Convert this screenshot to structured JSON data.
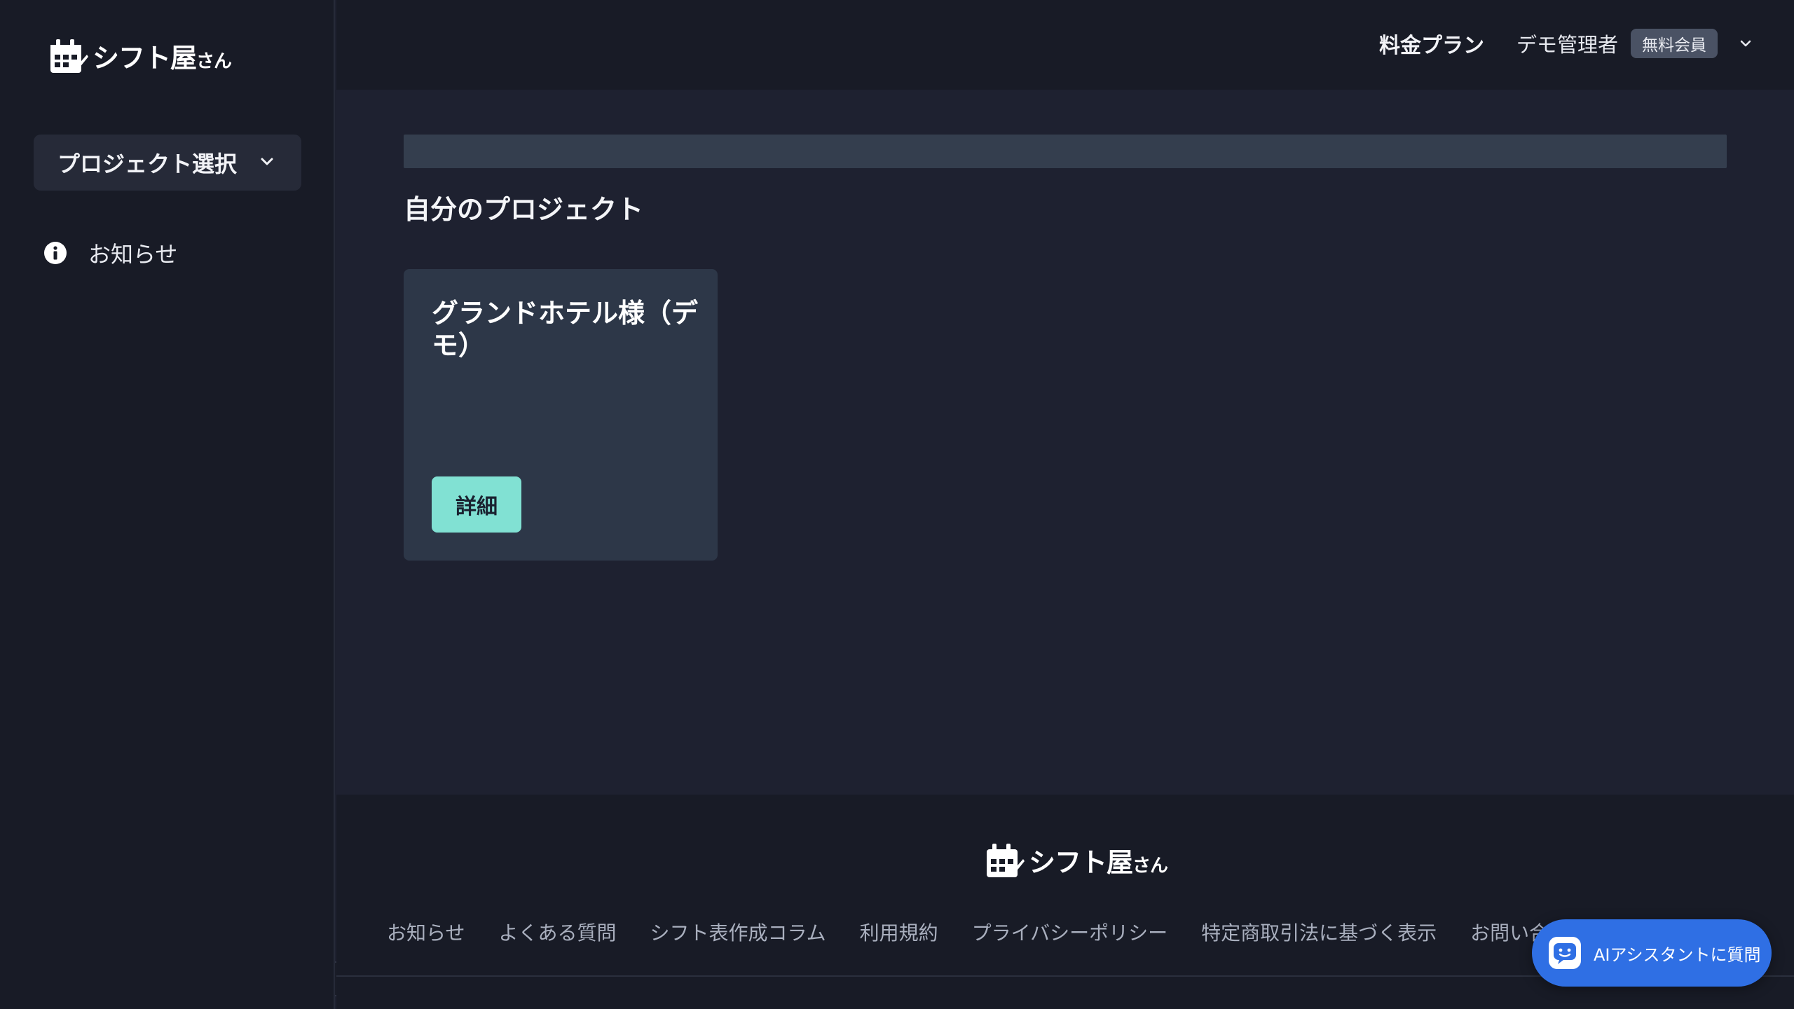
{
  "app": {
    "logo_text": "シフト屋",
    "logo_suffix": "さん"
  },
  "sidebar": {
    "project_select_label": "プロジェクト選択",
    "items": [
      {
        "label": "お知らせ",
        "icon": "info-icon"
      }
    ],
    "collapse_icon": "chevron-left-icon"
  },
  "header": {
    "pricing_label": "料金プラン",
    "user_name": "デモ管理者",
    "user_badge": "無料会員"
  },
  "main": {
    "section_title": "自分のプロジェクト",
    "projects": [
      {
        "name": "グランドホテル様（デモ）",
        "detail_label": "詳細"
      }
    ]
  },
  "footer": {
    "links": [
      "お知らせ",
      "よくある質問",
      "シフト表作成コラム",
      "利用規約",
      "プライバシーポリシー",
      "特定商取引法に基づく表示",
      "お問い合"
    ]
  },
  "assistant": {
    "label": "AIアシスタントに質問"
  },
  "colors": {
    "accent": "#81e1d3",
    "assistant": "#2f6fe4",
    "background": "#1e2130",
    "sidebar": "#181b26"
  }
}
